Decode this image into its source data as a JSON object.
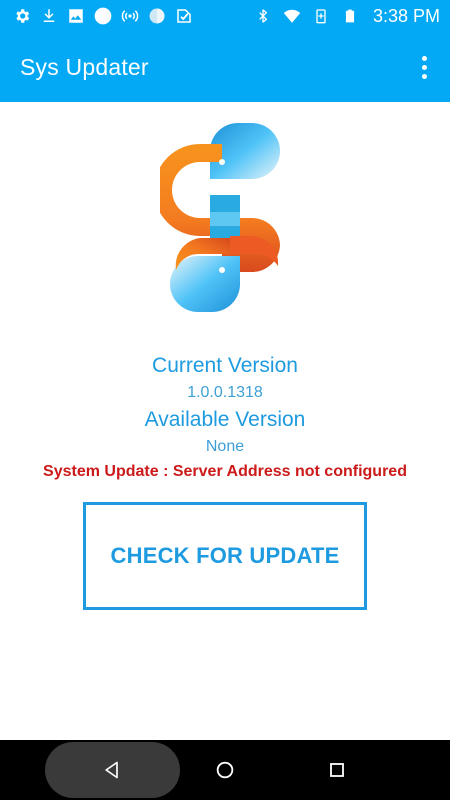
{
  "status_bar": {
    "time": "3:38 PM",
    "left_icons": [
      "gear-icon",
      "download-icon",
      "image-icon",
      "circle-icon",
      "hotspot-icon",
      "sync-icon",
      "check-shield-icon"
    ],
    "right_icons": [
      "bluetooth-icon",
      "wifi-icon",
      "battery-saver-icon",
      "battery-icon"
    ]
  },
  "app_bar": {
    "title": "Sys Updater",
    "menu_icon": "overflow-menu-icon"
  },
  "main": {
    "current_version_label": "Current Version",
    "current_version_value": "1.0.0.1318",
    "available_version_label": "Available Version",
    "available_version_value": "None",
    "status_message": "System Update : Server Address not configured",
    "check_button_label": "CHECK FOR UPDATE"
  },
  "nav_bar": {
    "buttons": [
      "back-icon",
      "home-icon",
      "recents-icon"
    ]
  },
  "colors": {
    "primary": "#03A9F4",
    "accent_text": "#1E9BE0",
    "error": "#CC1A1A",
    "logo_orange": "#F47B20",
    "logo_blue": "#29ABE2"
  }
}
